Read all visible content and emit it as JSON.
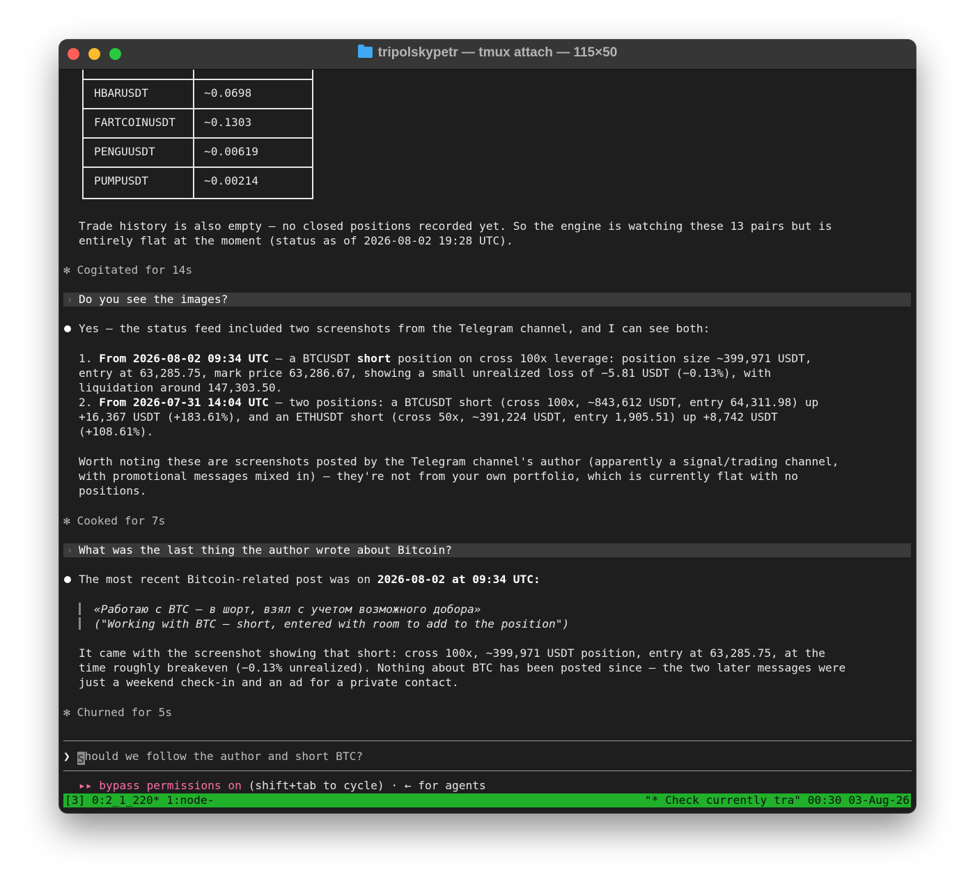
{
  "window": {
    "title": "tripolskypetr — tmux attach — 115×50",
    "folder_icon": "folder-icon"
  },
  "table": {
    "rows": [
      {
        "pair": "HBARUSDT",
        "price": "~0.0698"
      },
      {
        "pair": "FARTCOINUSDT",
        "price": "~0.1303"
      },
      {
        "pair": "PENGUUSDT",
        "price": "~0.00619"
      },
      {
        "pair": "PUMPUSDT",
        "price": "~0.00214"
      }
    ]
  },
  "msg1": {
    "line1": "Trade history is also empty — no closed positions recorded yet. So the engine is watching these 13 pairs but is",
    "line2": "entirely flat at the moment (status as of 2026-08-02 19:28 UTC)."
  },
  "cogitated": "Cogitated for 14s",
  "q1": "Do you see the images?",
  "a1": {
    "intro": "Yes — the status feed included two screenshots from the Telegram channel, and I can see both:",
    "item1_num": "1. ",
    "item1_date": "From 2026-08-02 09:34 UTC",
    "item1_mid": " — a BTCUSDT ",
    "item1_short": "short",
    "item1_rest": " position on cross 100x leverage: position size ~399,971 USDT,",
    "item1_line2": "entry at 63,285.75, mark price 63,286.67, showing a small unrealized loss of −5.81 USDT (−0.13%), with",
    "item1_line3": "liquidation around 147,303.50.",
    "item2_num": "2. ",
    "item2_date": "From 2026-07-31 14:04 UTC",
    "item2_rest": " — two positions: a BTCUSDT short (cross 100x, ~843,612 USDT, entry 64,311.98) up",
    "item2_line2": "+16,367 USDT (+183.61%), and an ETHUSDT short (cross 50x, ~391,224 USDT, entry 1,905.51) up +8,742 USDT",
    "item2_line3": "(+108.61%).",
    "note1": "Worth noting these are screenshots posted by the Telegram channel's author (apparently a signal/trading channel,",
    "note2": "with promotional messages mixed in) — they're not from your own portfolio, which is currently flat with no",
    "note3": "positions."
  },
  "cooked": "Cooked for 7s",
  "q2": "What was the last thing the author wrote about Bitcoin?",
  "a2": {
    "intro_pre": "The most recent Bitcoin-related post was on ",
    "intro_bold": "2026-08-02 at 09:34 UTC",
    "intro_post": ":",
    "quote1": "«Работаю с BTC — в шорт, взял с учетом возможного добора»",
    "quote2": "(\"Working with BTC — short, entered with room to add to the position\")",
    "body1": "It came with the screenshot showing that short: cross 100x, ~399,971 USDT position, entry at 63,285.75, at the",
    "body2": "time roughly breakeven (−0.13% unrealized). Nothing about BTC has been posted since — the two later messages were",
    "body3": "just a weekend check-in and an ad for a private contact."
  },
  "churned": "Churned for 5s",
  "input": {
    "prompt_symbol": "❯",
    "cursor_char": "S",
    "placeholder_rest": "hould we follow the author and short BTC?"
  },
  "permissions": {
    "arrows": "▸▸",
    "label": "bypass permissions on",
    "hint": " (shift+tab to cycle) · ← for agents"
  },
  "status_bar": {
    "left": "[3] 0:2_1_220* 1:node-",
    "right": "\"* Check currently tra\" 00:30 03-Aug-26"
  },
  "colors": {
    "terminal_bg": "#1e1e1e",
    "status_green": "#20b02a",
    "permission_pink": "#ff6fa8"
  }
}
